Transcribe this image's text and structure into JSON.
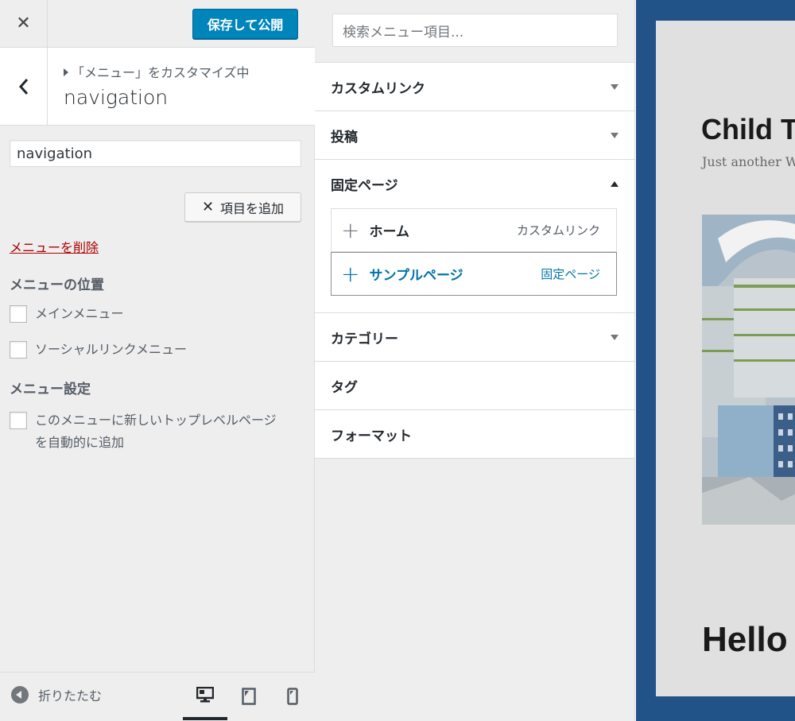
{
  "topbar": {
    "close_label": "✕",
    "publish_label": "保存して公開"
  },
  "section": {
    "breadcrumb": "「メニュー」をカスタマイズ中",
    "title": "navigation"
  },
  "menu_name": {
    "value": "navigation"
  },
  "add_items": {
    "label": "項目を追加"
  },
  "delete_menu": {
    "label": "メニューを削除"
  },
  "locations": {
    "heading": "メニューの位置",
    "items": [
      {
        "label": "メインメニュー",
        "checked": false
      },
      {
        "label": "ソーシャルリンクメニュー",
        "checked": false
      }
    ]
  },
  "settings": {
    "heading": "メニュー設定",
    "auto_add_line1": "このメニューに新しいトップレベルページ",
    "auto_add_line2": "を自動的に追加",
    "auto_add_checked": false
  },
  "footer": {
    "collapse_label": "折りたたむ",
    "devices": [
      "desktop",
      "tablet",
      "mobile"
    ],
    "active_device": "desktop"
  },
  "available": {
    "search_placeholder": "検索メニュー項目...",
    "sections": [
      {
        "title": "カスタムリンク",
        "state": "collapsed"
      },
      {
        "title": "投稿",
        "state": "collapsed"
      },
      {
        "title": "固定ページ",
        "state": "expanded"
      },
      {
        "title": "カテゴリー",
        "state": "collapsed"
      },
      {
        "title": "タグ",
        "state": "none"
      },
      {
        "title": "フォーマット",
        "state": "none"
      }
    ],
    "page_items": [
      {
        "title": "ホーム",
        "type": "カスタムリンク"
      },
      {
        "title": "サンプルページ",
        "type": "固定ページ"
      }
    ]
  },
  "preview": {
    "site_title": "Child T",
    "tagline": "Just another W",
    "post_title": "Hello"
  },
  "colors": {
    "primary": "#0085ba",
    "link": "#0073aa",
    "delete": "#a00",
    "preview_frame": "#215389"
  }
}
